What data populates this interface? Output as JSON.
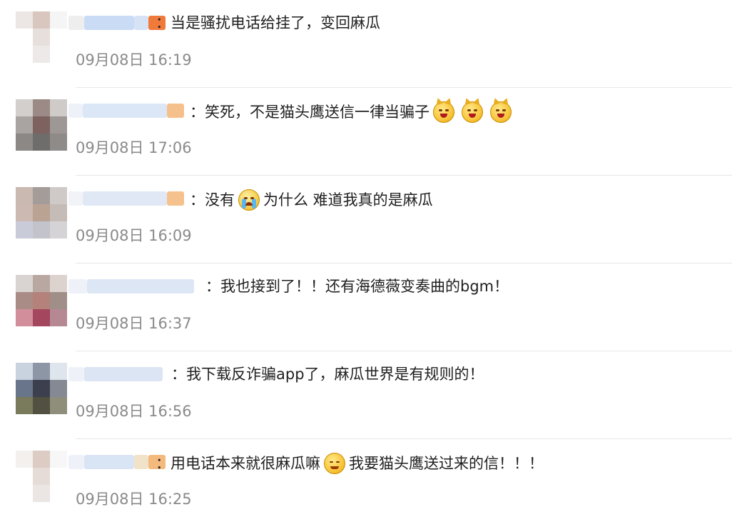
{
  "comments": [
    {
      "text_parts": [
        "：当是骚扰电话给挂了，变回麻瓜"
      ],
      "emojis": [],
      "timestamp": "09月08日 16:19"
    },
    {
      "text_parts": [
        "：笑死，不是猫头鹰送信一律当骗子"
      ],
      "emojis": [
        "cat-emoji",
        "cat-emoji",
        "cat-emoji"
      ],
      "timestamp": "09月08日 17:06"
    },
    {
      "text_parts": [
        "：没有",
        "为什么 难道我真的是麻瓜"
      ],
      "emojis": [
        "crying-emoji"
      ],
      "timestamp": "09月08日 16:09"
    },
    {
      "text_parts": [
        "：我也接到了！！还有海德薇变奏曲的bgm！"
      ],
      "emojis": [],
      "timestamp": "09月08日 16:37"
    },
    {
      "text_parts": [
        "：我下载反诈骗app了，麻瓜世界是有规则的！"
      ],
      "emojis": [],
      "timestamp": "09月08日 16:56"
    },
    {
      "text_parts": [
        "：用电话本来就很麻瓜嘛",
        "我要猫头鹰送过来的信！！！"
      ],
      "emojis": [
        "sly-grin-emoji"
      ],
      "timestamp": "09月08日 16:25"
    }
  ],
  "colors": {
    "timestamp": "#8a8a8a",
    "text": "#1f1f1f",
    "divider": "#e7e7e7",
    "username_accent": "#f07a3a"
  }
}
